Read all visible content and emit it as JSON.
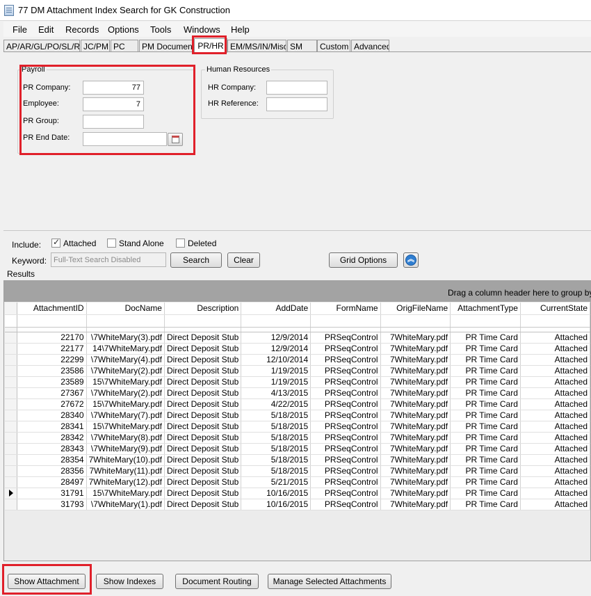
{
  "window": {
    "title": "77 DM Attachment Index Search for GK Construction"
  },
  "menu": [
    "File",
    "Edit",
    "Records",
    "Options",
    "Tools",
    "Windows",
    "Help"
  ],
  "tabs": [
    "AP/AR/GL/PO/SL/RQ",
    "JC/PM",
    "PC",
    "PM Documents",
    "PR/HR",
    "EM/MS/IN/Misc.",
    "SM",
    "Custom",
    "Advanced"
  ],
  "payroll": {
    "title": "Payroll",
    "pr_company_label": "PR Company:",
    "pr_company_value": "77",
    "employee_label": "Employee:",
    "employee_value": "7",
    "pr_group_label": "PR Group:",
    "pr_group_value": "",
    "pr_end_date_label": "PR End Date:",
    "pr_end_date_value": ""
  },
  "hr": {
    "title": "Human Resources",
    "hr_company_label": "HR Company:",
    "hr_company_value": "",
    "hr_reference_label": "HR Reference:",
    "hr_reference_value": ""
  },
  "filters": {
    "include_label": "Include:",
    "attached_label": "Attached",
    "attached_checked": true,
    "stand_alone_label": "Stand Alone",
    "stand_alone_checked": false,
    "deleted_label": "Deleted",
    "deleted_checked": false,
    "keyword_label": "Keyword:",
    "keyword_placeholder": "Full-Text Search Disabled",
    "search_button": "Search",
    "clear_button": "Clear",
    "grid_options_button": "Grid Options"
  },
  "results": {
    "label": "Results",
    "group_hint": "Drag a column header here to group by tha",
    "columns": [
      "AttachmentID",
      "DocName",
      "Description",
      "AddDate",
      "FormName",
      "OrigFileName",
      "AttachmentType",
      "CurrentState"
    ],
    "rows": [
      [
        "22170",
        "\\7WhiteMary(3).pdf",
        "Direct Deposit Stub",
        "12/9/2014",
        "PRSeqControl",
        "7WhiteMary.pdf",
        "PR Time Card",
        "Attached"
      ],
      [
        "22177",
        "14\\7WhiteMary.pdf",
        "Direct Deposit Stub",
        "12/9/2014",
        "PRSeqControl",
        "7WhiteMary.pdf",
        "PR Time Card",
        "Attached"
      ],
      [
        "22299",
        "\\7WhiteMary(4).pdf",
        "Direct Deposit Stub",
        "12/10/2014",
        "PRSeqControl",
        "7WhiteMary.pdf",
        "PR Time Card",
        "Attached"
      ],
      [
        "23586",
        "\\7WhiteMary(2).pdf",
        "Direct Deposit Stub",
        "1/19/2015",
        "PRSeqControl",
        "7WhiteMary.pdf",
        "PR Time Card",
        "Attached"
      ],
      [
        "23589",
        "15\\7WhiteMary.pdf",
        "Direct Deposit Stub",
        "1/19/2015",
        "PRSeqControl",
        "7WhiteMary.pdf",
        "PR Time Card",
        "Attached"
      ],
      [
        "27367",
        "\\7WhiteMary(2).pdf",
        "Direct Deposit Stub",
        "4/13/2015",
        "PRSeqControl",
        "7WhiteMary.pdf",
        "PR Time Card",
        "Attached"
      ],
      [
        "27672",
        "15\\7WhiteMary.pdf",
        "Direct Deposit Stub",
        "4/22/2015",
        "PRSeqControl",
        "7WhiteMary.pdf",
        "PR Time Card",
        "Attached"
      ],
      [
        "28340",
        "\\7WhiteMary(7).pdf",
        "Direct Deposit Stub",
        "5/18/2015",
        "PRSeqControl",
        "7WhiteMary.pdf",
        "PR Time Card",
        "Attached"
      ],
      [
        "28341",
        "15\\7WhiteMary.pdf",
        "Direct Deposit Stub",
        "5/18/2015",
        "PRSeqControl",
        "7WhiteMary.pdf",
        "PR Time Card",
        "Attached"
      ],
      [
        "28342",
        "\\7WhiteMary(8).pdf",
        "Direct Deposit Stub",
        "5/18/2015",
        "PRSeqControl",
        "7WhiteMary.pdf",
        "PR Time Card",
        "Attached"
      ],
      [
        "28343",
        "\\7WhiteMary(9).pdf",
        "Direct Deposit Stub",
        "5/18/2015",
        "PRSeqControl",
        "7WhiteMary.pdf",
        "PR Time Card",
        "Attached"
      ],
      [
        "28354",
        "7WhiteMary(10).pdf",
        "Direct Deposit Stub",
        "5/18/2015",
        "PRSeqControl",
        "7WhiteMary.pdf",
        "PR Time Card",
        "Attached"
      ],
      [
        "28356",
        "7WhiteMary(11).pdf",
        "Direct Deposit Stub",
        "5/18/2015",
        "PRSeqControl",
        "7WhiteMary.pdf",
        "PR Time Card",
        "Attached"
      ],
      [
        "28497",
        "7WhiteMary(12).pdf",
        "Direct Deposit Stub",
        "5/21/2015",
        "PRSeqControl",
        "7WhiteMary.pdf",
        "PR Time Card",
        "Attached"
      ],
      [
        "31791",
        "15\\7WhiteMary.pdf",
        "Direct Deposit Stub",
        "10/16/2015",
        "PRSeqControl",
        "7WhiteMary.pdf",
        "PR Time Card",
        "Attached"
      ],
      [
        "31793",
        "\\7WhiteMary(1).pdf",
        "Direct Deposit Stub",
        "10/16/2015",
        "PRSeqControl",
        "7WhiteMary.pdf",
        "PR Time Card",
        "Attached"
      ]
    ],
    "current_row": 14
  },
  "actions": [
    "Show Attachment",
    "Show Indexes",
    "Document Routing",
    "Manage Selected Attachments"
  ],
  "colors": {
    "highlight": "#e0202a",
    "group_bar": "#a3a3a3",
    "accent": "#2f7ed1"
  },
  "icons": [
    "app-icon",
    "calendar-icon",
    "collapse-up-icon",
    "row-indicator-icon"
  ]
}
